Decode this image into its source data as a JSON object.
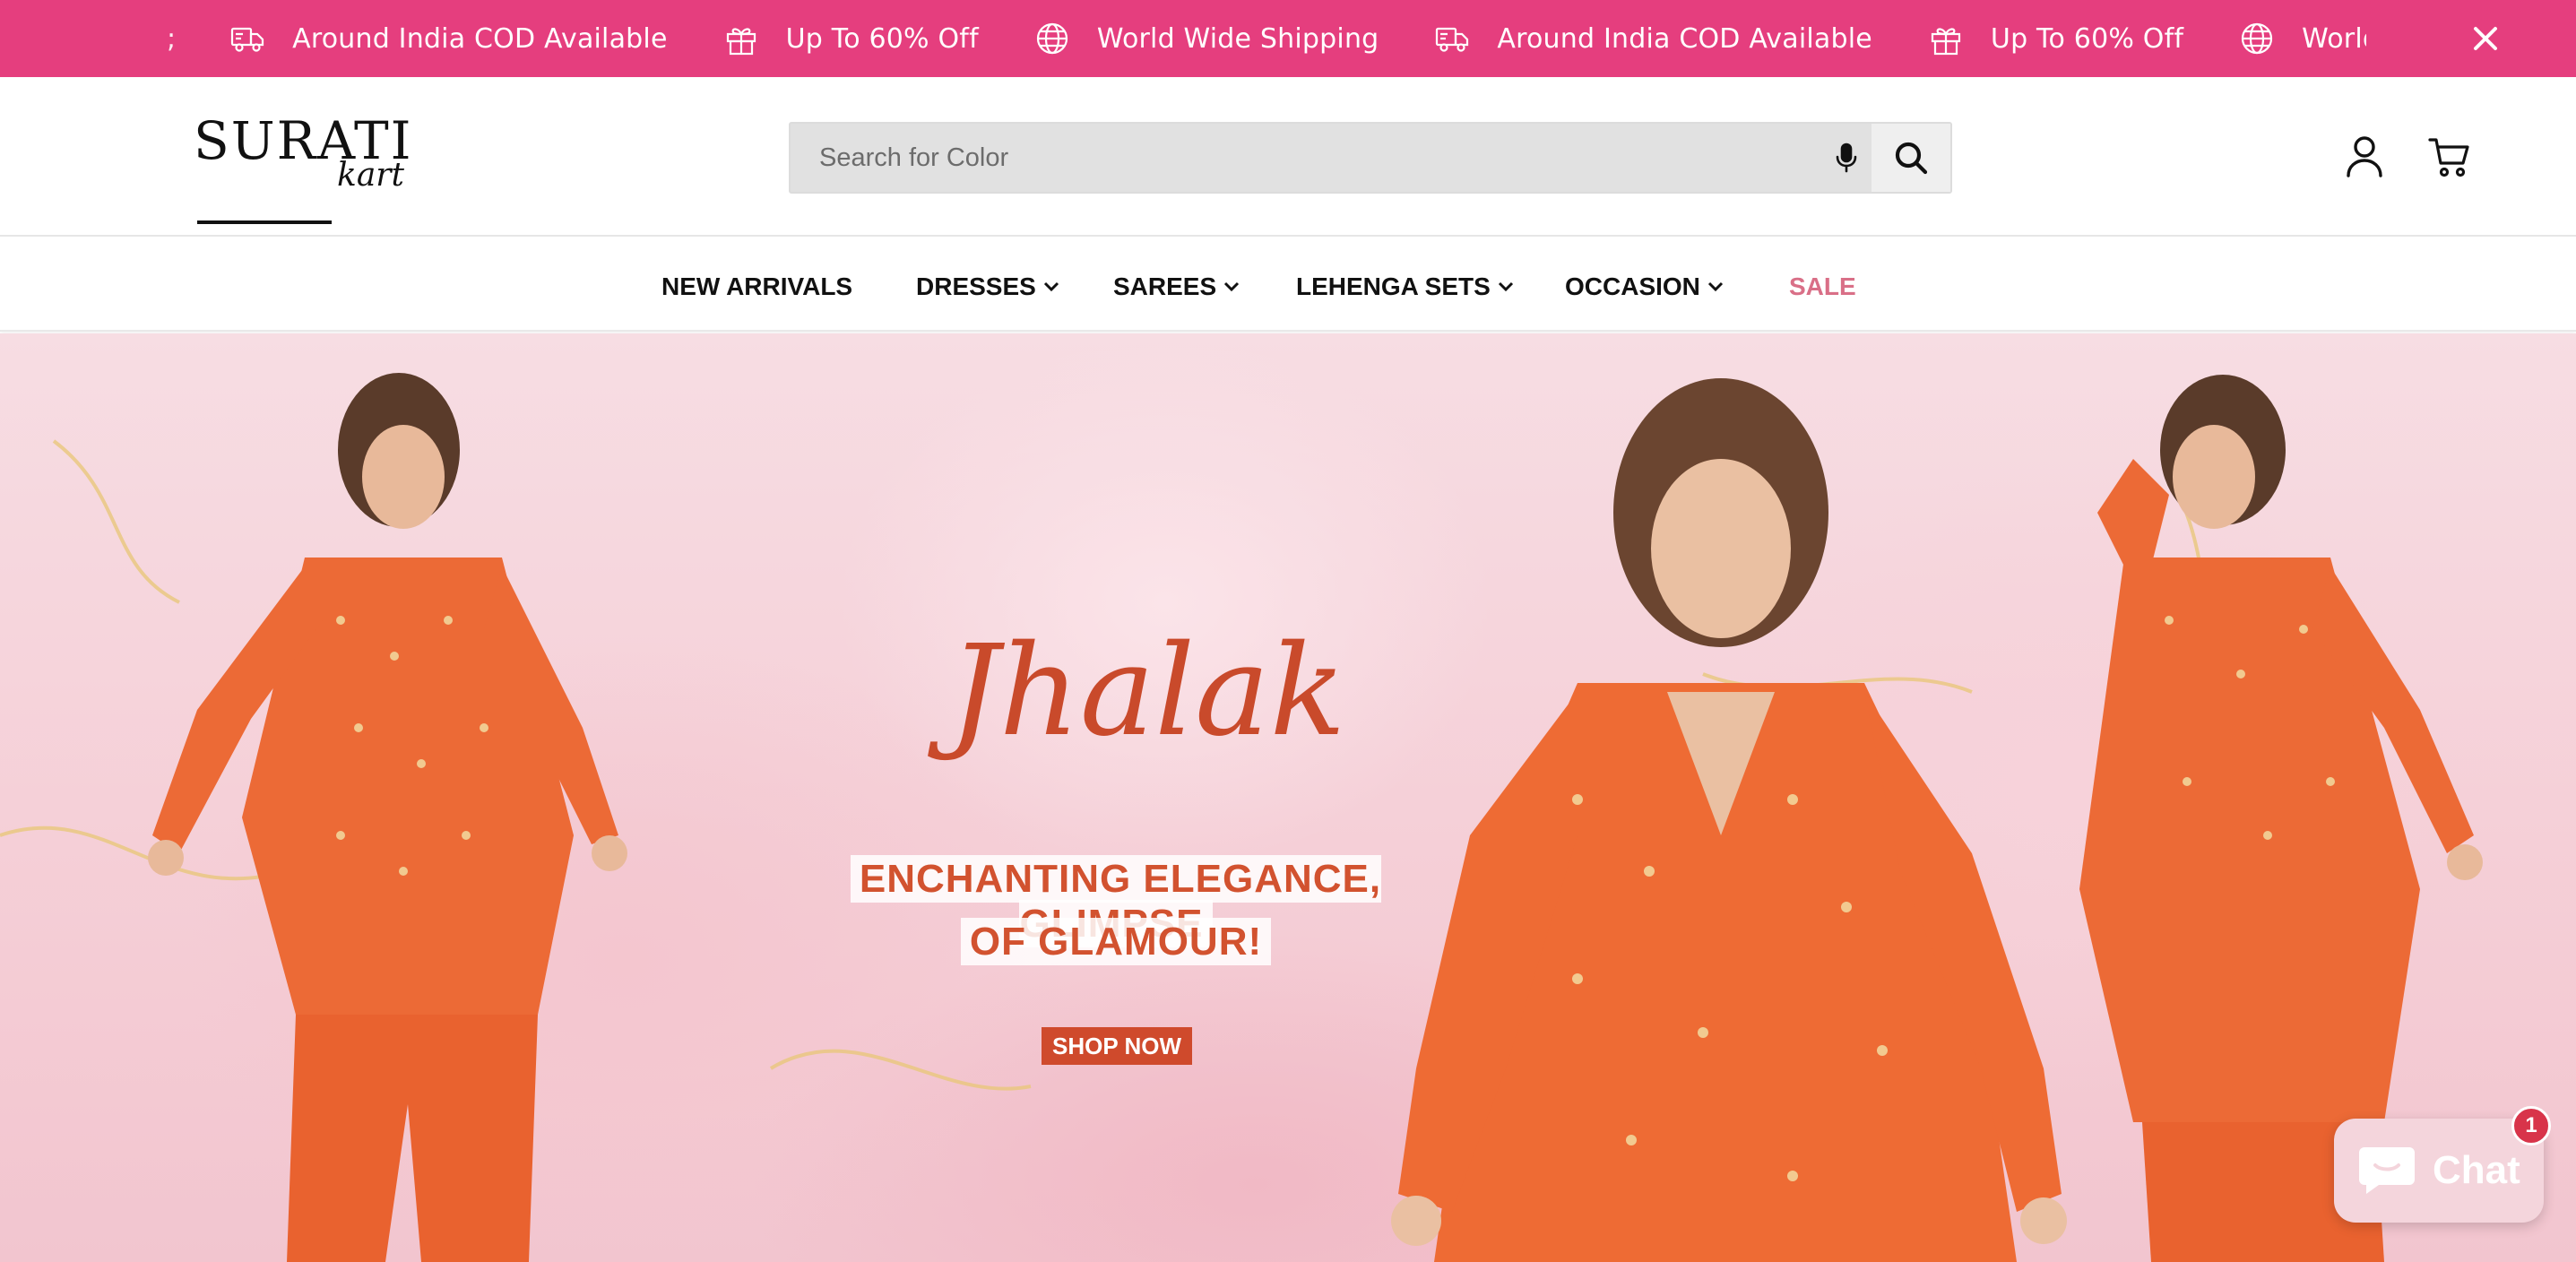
{
  "announcement": {
    "background": "#e53e7e",
    "edge_fragment": ";",
    "items": [
      {
        "icon": "delivery-truck-icon",
        "text": "Around India COD Available"
      },
      {
        "icon": "gift-icon",
        "text": "Up To 60% Off"
      },
      {
        "icon": "globe-icon",
        "text": "World Wide Shipping"
      },
      {
        "icon": "delivery-truck-icon",
        "text": "Around India COD Available"
      },
      {
        "icon": "gift-icon",
        "text": "Up To 60% Off"
      },
      {
        "icon": "globe-icon",
        "text": "World Wide Shipping"
      }
    ],
    "close_icon": "close-icon"
  },
  "header": {
    "logo": {
      "main": "SURATI",
      "sub": "kart"
    },
    "search": {
      "placeholder": "Search for Color",
      "value": "",
      "mic_icon": "microphone-icon",
      "button_icon": "search-icon"
    },
    "account_icon": "user-icon",
    "cart_icon": "cart-icon"
  },
  "nav": {
    "items": [
      {
        "label": "NEW ARRIVALS",
        "dropdown": false
      },
      {
        "label": "DRESSES",
        "dropdown": true
      },
      {
        "label": "SAREES",
        "dropdown": true
      },
      {
        "label": "LEHENGA SETS",
        "dropdown": true
      },
      {
        "label": "OCCASION",
        "dropdown": true
      },
      {
        "label": "SALE",
        "dropdown": false,
        "color": "#d96f87"
      }
    ]
  },
  "hero": {
    "script_title": "Jhalak",
    "tagline_line1": "ENCHANTING ELEGANCE, GLIMPSE",
    "tagline_line2": "OF GLAMOUR!",
    "cta": "SHOP NOW",
    "accent": "#cf4a2c"
  },
  "chat": {
    "label": "Chat",
    "badge": "1",
    "icon": "chat-bubble-icon"
  }
}
